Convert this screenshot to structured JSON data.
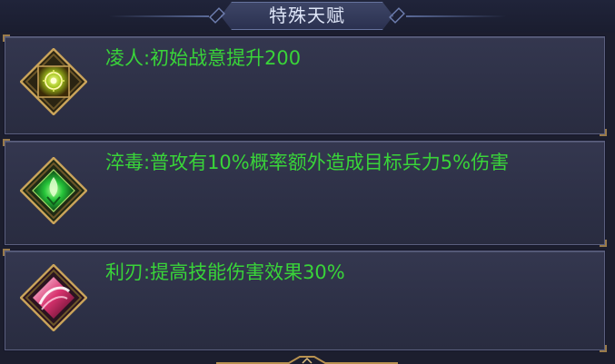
{
  "header": {
    "title": "特殊天赋"
  },
  "talents": [
    {
      "description": "凌人:初始战意提升200",
      "icon": "golden-glow-rune-icon",
      "gem_color": "#b6d52a"
    },
    {
      "description": "淬毒:普攻有10%概率额外造成目标兵力5%伤害",
      "icon": "green-poison-gem-icon",
      "gem_color": "#2fd64a"
    },
    {
      "description": "利刃:提高技能伤害效果30%",
      "icon": "crimson-blade-swirl-icon",
      "gem_color": "#d8326e"
    }
  ],
  "colors": {
    "talent_text": "#39d439",
    "frame_gold": "#b89250",
    "panel_bg": "#30334a"
  }
}
